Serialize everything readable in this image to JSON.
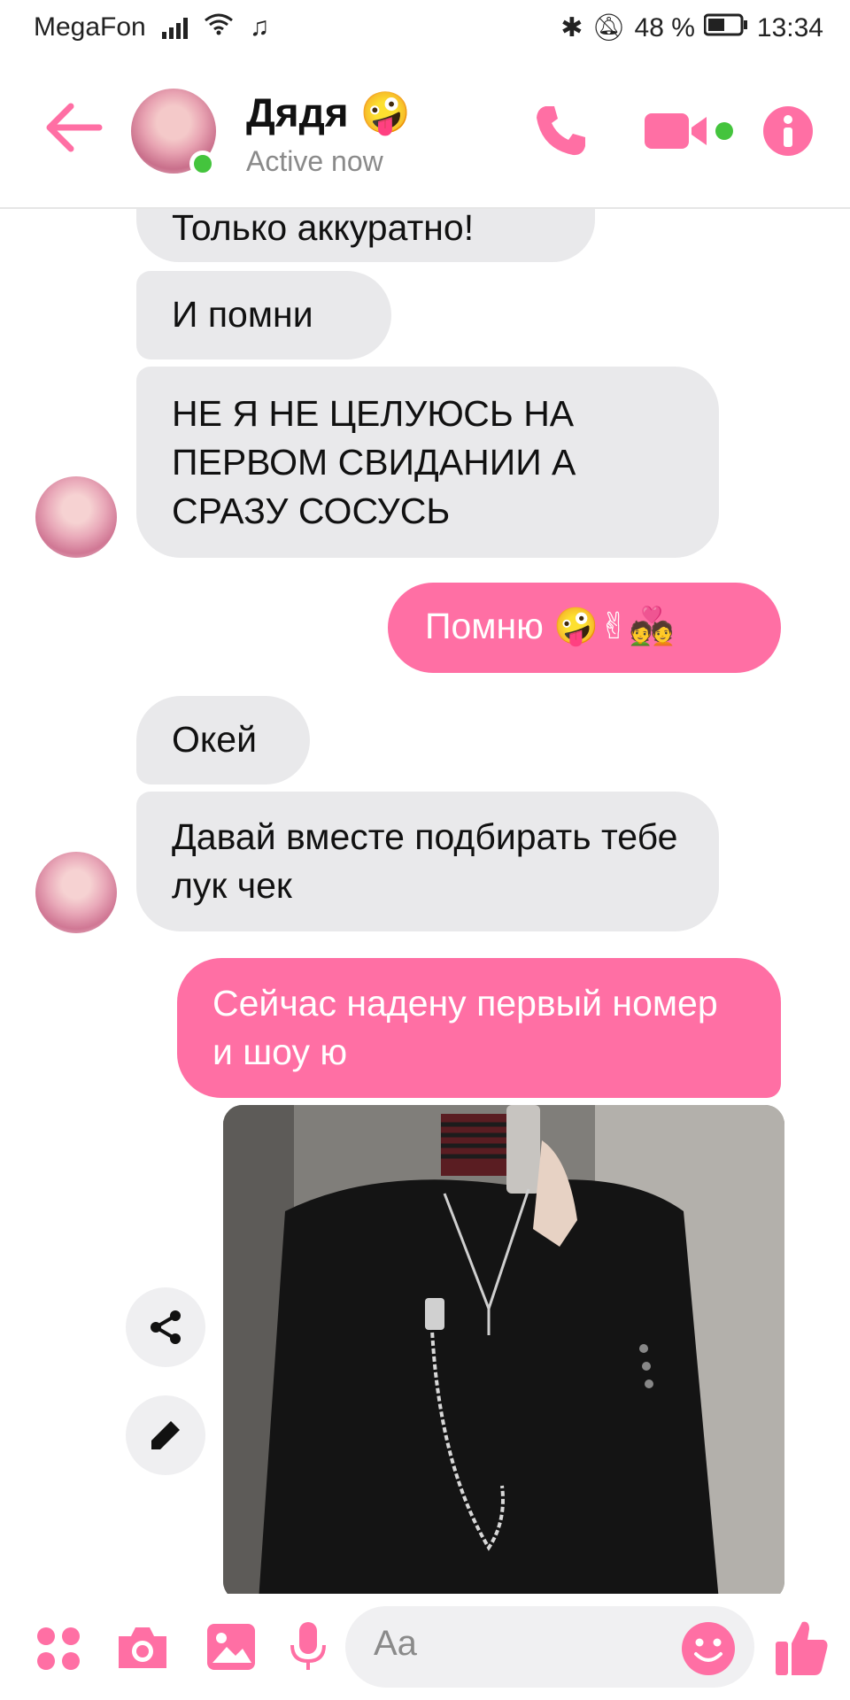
{
  "status_bar": {
    "carrier": "MegaFon",
    "battery": "48 %",
    "time": "13:34"
  },
  "header": {
    "contact_name": "Дядя",
    "contact_emoji": "🤪",
    "status": "Active now"
  },
  "messages": [
    {
      "side": "in",
      "text": "Только аккуратно!"
    },
    {
      "side": "in",
      "text": "И помни"
    },
    {
      "side": "in",
      "text": "НЕ Я НЕ ЦЕЛУЮСЬ НА ПЕРВОМ СВИДАНИИ А СРАЗУ СОСУСЬ"
    },
    {
      "side": "out",
      "text": "Помню 🤪✌💑"
    },
    {
      "side": "in",
      "text": "Окей"
    },
    {
      "side": "in",
      "text": "Давай вместе подбирать тебе лук чек"
    },
    {
      "side": "out",
      "text": "Сейчас надену первый номер и шоу ю"
    },
    {
      "side": "out",
      "type": "photo"
    }
  ],
  "composer": {
    "placeholder": "Aa"
  },
  "colors": {
    "accent": "#ff6fa4",
    "incoming_bubble": "#e9e9eb",
    "online": "#44c43d"
  },
  "icons": [
    "back-arrow-icon",
    "phone-icon",
    "video-camera-icon",
    "info-icon",
    "share-icon",
    "pencil-icon",
    "apps-icon",
    "camera-icon",
    "gallery-icon",
    "microphone-icon",
    "emoji-icon",
    "thumbs-up-icon"
  ]
}
